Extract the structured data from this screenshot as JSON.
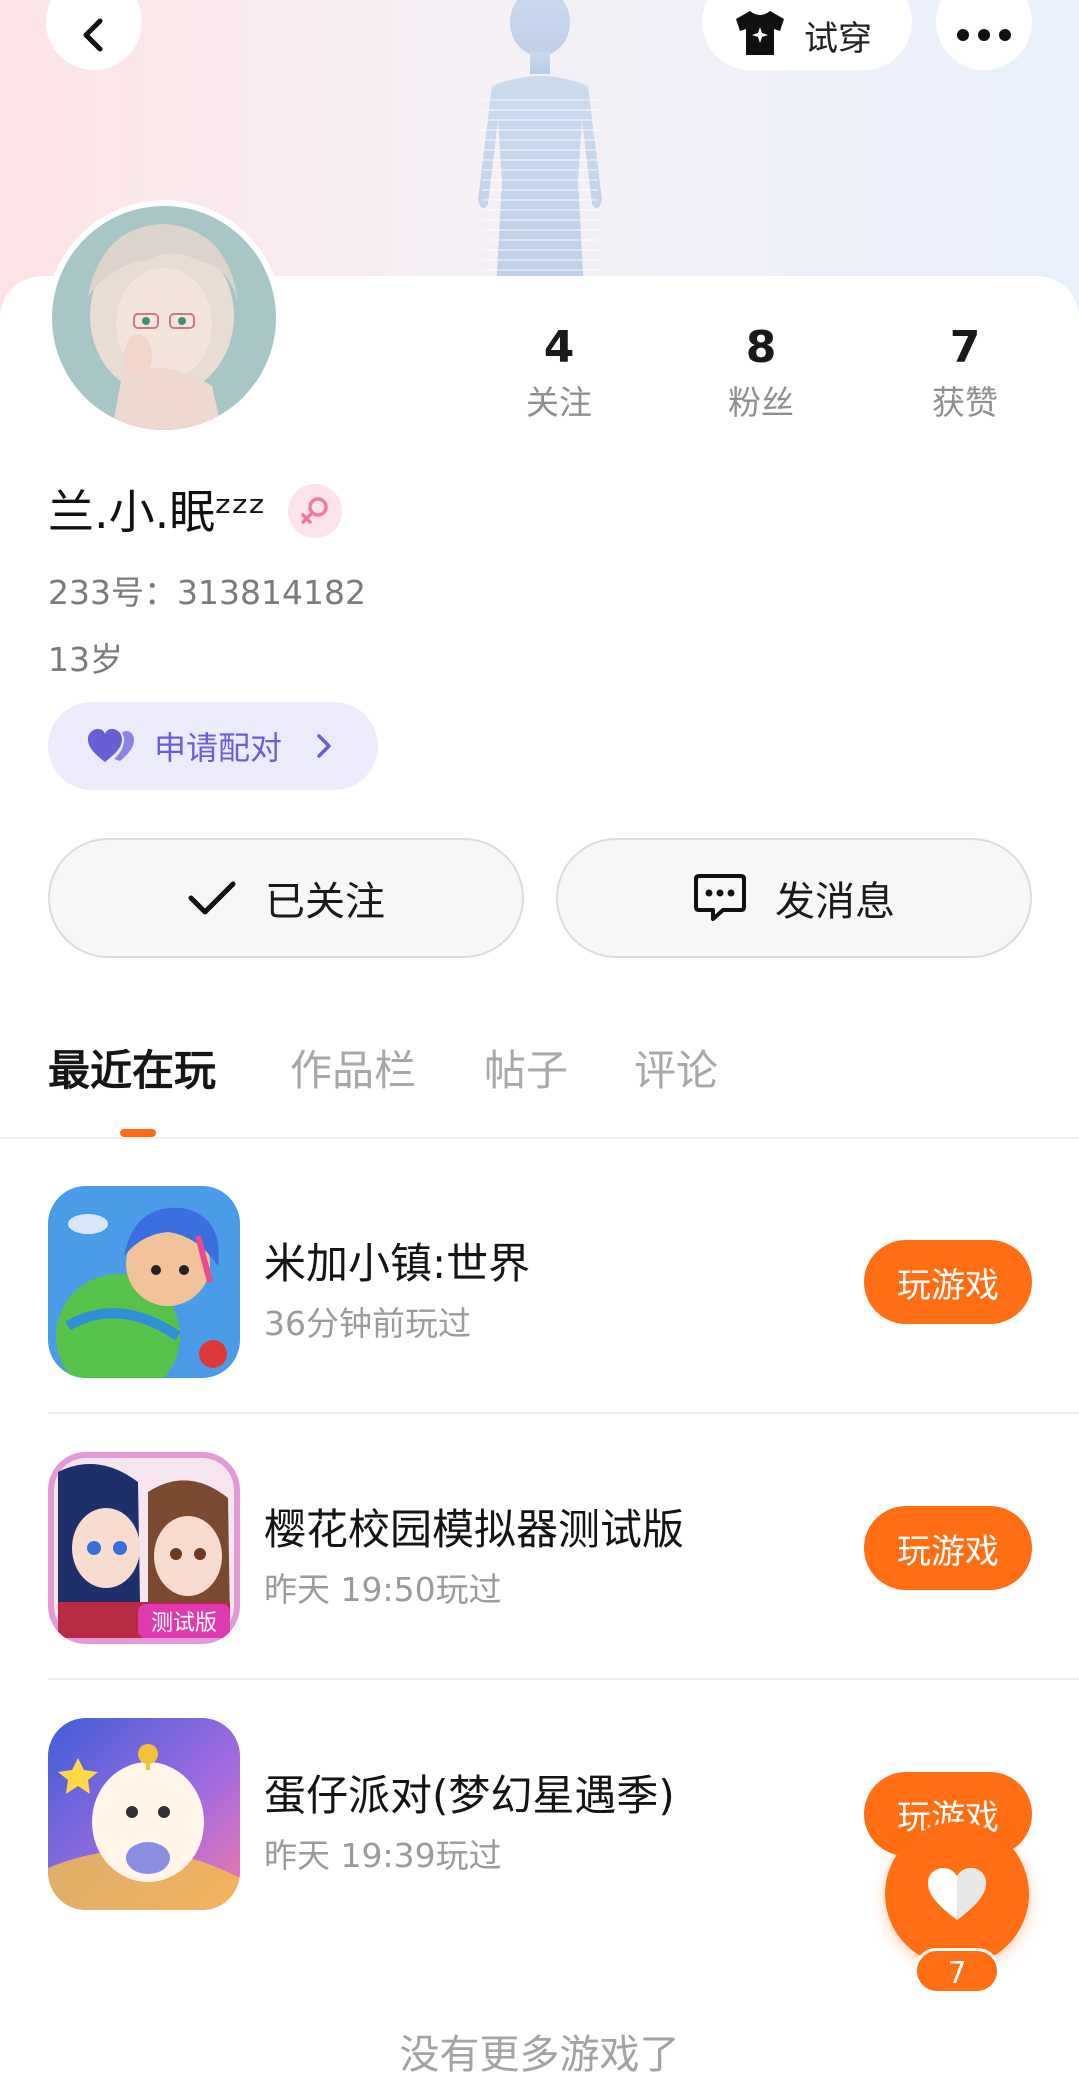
{
  "header": {
    "back_icon": "chevron-left-icon",
    "tryon_label": "试穿",
    "tryon_icon": "shirt-sparkle-icon",
    "more_icon": "more-dots-icon"
  },
  "profile": {
    "avatar": "anime-girl-avatar",
    "stats": [
      {
        "value": "4",
        "label": "关注"
      },
      {
        "value": "8",
        "label": "粉丝"
      },
      {
        "value": "7",
        "label": "获赞"
      }
    ],
    "nickname": "兰.小.眠ᶻᶻᶻ",
    "gender_icon": "female-icon",
    "uid": "233号：313814182",
    "age": "13岁",
    "pair_label": "申请配对",
    "pair_icon": "heart-pair-icon"
  },
  "actions": {
    "follow_label": "已关注",
    "message_label": "发消息"
  },
  "tabs": [
    "最近在玩",
    "作品栏",
    "帖子",
    "评论"
  ],
  "active_tab": "最近在玩",
  "games": [
    {
      "title": "米加小镇:世界",
      "subtitle": "36分钟前玩过",
      "button": "玩游戏"
    },
    {
      "title": "樱花校园模拟器测试版",
      "subtitle": "昨天 19:50玩过",
      "button": "玩游戏"
    },
    {
      "title": "蛋仔派对(梦幻星遇季)",
      "subtitle": "昨天 19:39玩过",
      "button": "玩游戏"
    }
  ],
  "footer_text": "没有更多游戏了",
  "like_fab": {
    "count": "7",
    "icon": "heart-icon"
  },
  "colors": {
    "accent": "#ff6e12",
    "pair_bg": "#ecebfb",
    "pair_text": "#6a5ed6"
  }
}
